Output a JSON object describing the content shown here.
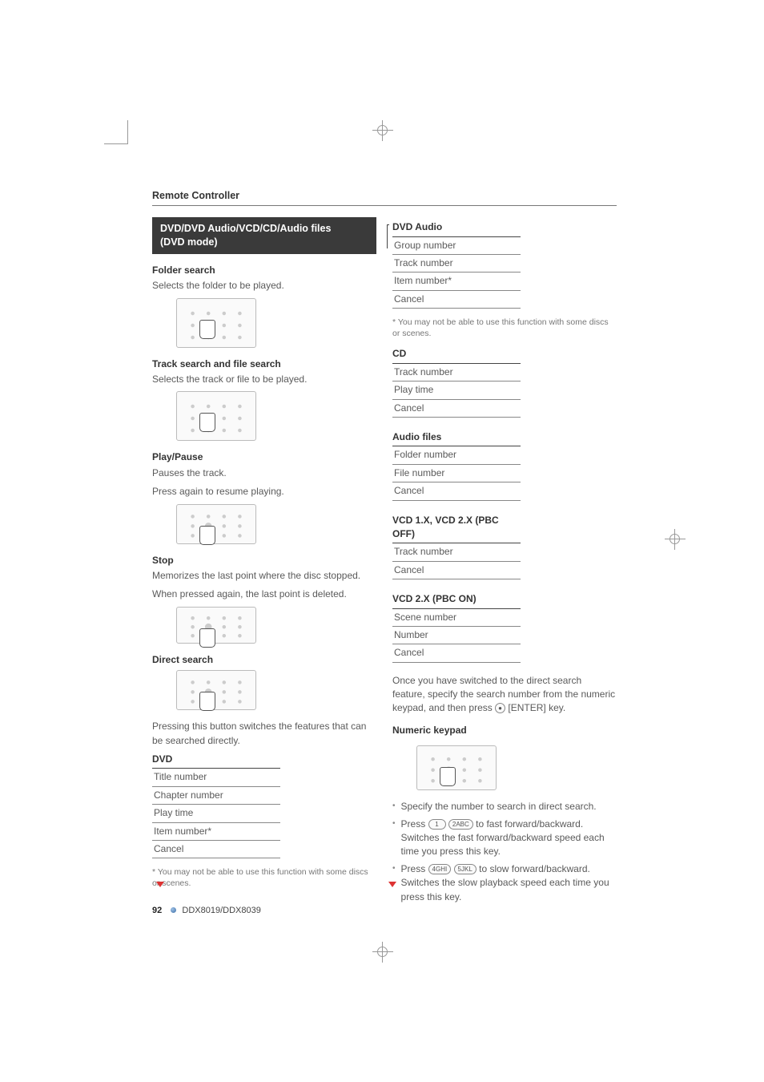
{
  "header": "Remote Controller",
  "mode_box": {
    "line1": "DVD/DVD Audio/VCD/CD/Audio files",
    "line2": "(DVD mode)"
  },
  "left": {
    "folder_search": {
      "title": "Folder search",
      "desc": "Selects the folder to be played."
    },
    "track_file_search": {
      "title": "Track search and file search",
      "desc": "Selects the track or file to be played."
    },
    "play_pause": {
      "title": "Play/Pause",
      "desc1": "Pauses the track.",
      "desc2": "Press again to resume playing."
    },
    "stop": {
      "title": "Stop",
      "desc1": "Memorizes the last point where the disc stopped.",
      "desc2": "When pressed again, the last point is deleted."
    },
    "direct_search": {
      "title": "Direct search",
      "desc": "Pressing this button switches the features that can be searched directly."
    },
    "dvd_table": {
      "head": "DVD",
      "rows": [
        "Title number",
        "Chapter number",
        "Play time",
        "Item number*",
        "Cancel"
      ]
    },
    "dvd_footnote": "* You may not be able to use this function with some discs or scenes."
  },
  "right": {
    "dvd_audio_table": {
      "head": "DVD Audio",
      "rows": [
        "Group number",
        "Track number",
        "Item number*",
        "Cancel"
      ]
    },
    "dvd_audio_footnote": "* You may not be able to use this function with some discs or scenes.",
    "cd_table": {
      "head": "CD",
      "rows": [
        "Track number",
        "Play time",
        "Cancel"
      ]
    },
    "audio_files_table": {
      "head": "Audio files",
      "rows": [
        "Folder number",
        "File number",
        "Cancel"
      ]
    },
    "vcd1_table": {
      "head": "VCD 1.X, VCD 2.X (PBC OFF)",
      "rows": [
        "Track number",
        "Cancel"
      ]
    },
    "vcd2_table": {
      "head": "VCD 2.X (PBC ON)",
      "rows": [
        "Scene number",
        "Number",
        "Cancel"
      ]
    },
    "direct_instr": "Once you have switched to the direct search feature, specify the search number from the numeric keypad, and then press ",
    "direct_instr_tail": " [ENTER] key.",
    "numeric_keypad_title": "Numeric keypad",
    "bullets": {
      "b1": "Specify the number to search in direct search.",
      "b2_pre": "Press ",
      "b2_k1": "1",
      "b2_k2": "2ABC",
      "b2_post": " to fast forward/backward. Switches the fast forward/backward speed each time you press this key.",
      "b3_pre": "Press ",
      "b3_k1": "4GHI",
      "b3_k2": "5JKL",
      "b3_post": " to slow forward/backward. Switches the slow playback speed each time you press this key."
    }
  },
  "footer": {
    "page": "92",
    "model": "DDX8019/DDX8039"
  }
}
